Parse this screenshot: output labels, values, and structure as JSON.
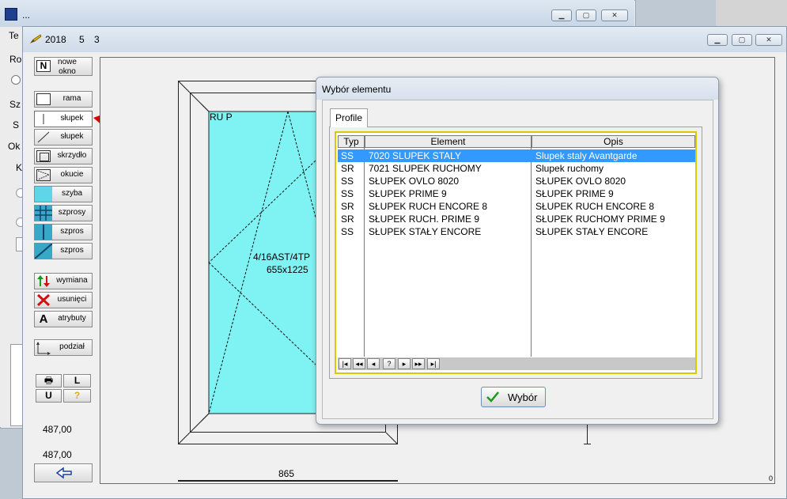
{
  "back_window": {
    "title": "...",
    "side_letters": [
      "Te",
      "Ro",
      "Sz",
      "S",
      "Ok",
      "K"
    ]
  },
  "main_window": {
    "date_year": "2018",
    "date_month": "5",
    "date_day": "3"
  },
  "toolbar": {
    "new_window": "nowe okno",
    "frame": "rama",
    "mullion_selected": "słupek",
    "mullion": "słupek",
    "sash": "skrzydło",
    "hardware": "okucie",
    "glass": "szyba",
    "glazing_bars": "szprosy",
    "glazing_bar_1": "szpros",
    "glazing_bar_2": "szpros",
    "replace": "wymiana",
    "delete": "usunięci",
    "attributes": "atrybuty",
    "split": "podział",
    "print_icon": "printer-icon",
    "l_button": "L",
    "u_button": "U",
    "help_label": "?",
    "value_1": "487,00",
    "value_2": "487,00"
  },
  "drawing": {
    "sash_label": "RU P",
    "glass_spec": "4/16AST/4TP",
    "glass_size": "655x1225",
    "width_dim": "865",
    "corner_label": "0"
  },
  "dialog": {
    "title": "Wybór elementu",
    "tab": "Profile",
    "columns": [
      "Typ",
      "Element",
      "Opis"
    ],
    "rows": [
      {
        "typ": "SS",
        "element": "7020 SLUPEK STALY",
        "opis": "Slupek staly Avantgarde",
        "selected": true
      },
      {
        "typ": "SR",
        "element": "7021 SLUPEK RUCHOMY",
        "opis": "Slupek ruchomy",
        "selected": false
      },
      {
        "typ": "SS",
        "element": "SŁUPEK OVLO 8020",
        "opis": "SŁUPEK OVLO 8020",
        "selected": false
      },
      {
        "typ": "SS",
        "element": "SŁUPEK PRIME 9",
        "opis": "SŁUPEK PRIME 9",
        "selected": false
      },
      {
        "typ": "SR",
        "element": "SŁUPEK RUCH ENCORE 8",
        "opis": "SŁUPEK RUCH ENCORE 8",
        "selected": false
      },
      {
        "typ": "SR",
        "element": "SŁUPEK RUCH. PRIME 9",
        "opis": "SŁUPEK RUCHOMY PRIME 9",
        "selected": false
      },
      {
        "typ": "SS",
        "element": "SŁUPEK STAŁY ENCORE",
        "opis": "SŁUPEK STAŁY ENCORE",
        "selected": false
      }
    ],
    "nav": [
      "|◂",
      "◂◂",
      "◂",
      "?",
      "▸",
      "▸▸",
      "▸|"
    ],
    "select_button": "Wybór"
  },
  "colors": {
    "selection": "#3399ff",
    "glass": "#7ff3f3",
    "table_border": "#d8c800",
    "arrow": "#e00000"
  }
}
